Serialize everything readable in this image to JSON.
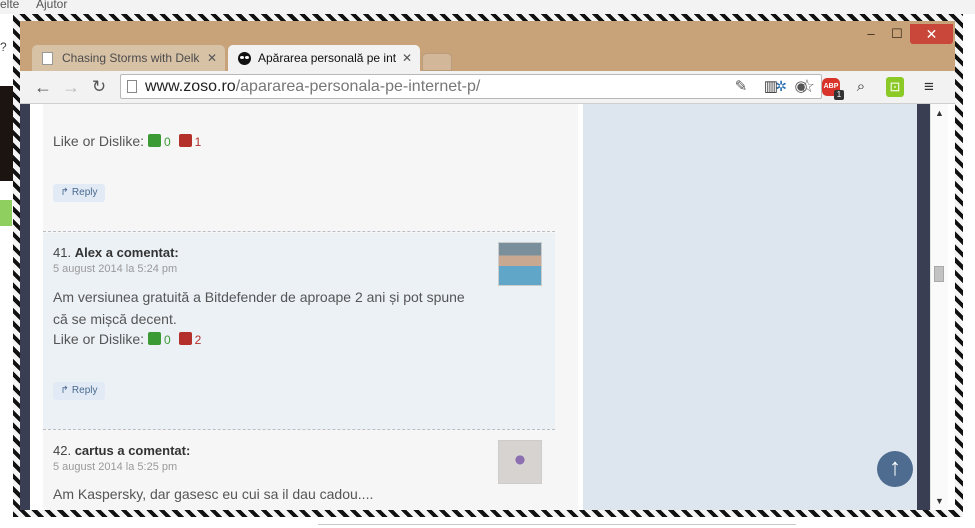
{
  "background": {
    "menu_left": "elte",
    "menu_right": "Ajutor",
    "q_mark": "?"
  },
  "window": {
    "min": "–",
    "max": "☐",
    "close": "✕"
  },
  "tabs": [
    {
      "label": "Chasing Storms with Delk",
      "close": "✕",
      "icon": "page-icon"
    },
    {
      "label": "Apărarea personală pe int",
      "close": "✕",
      "icon": "alien-icon"
    }
  ],
  "toolbar": {
    "url_domain": "www.zoso.ro",
    "url_path": "/apararea-personala-pe-internet-p/",
    "abp_label": "ABP",
    "abp_badge": "1"
  },
  "comments": [
    {
      "likes_label": "Like or Dislike:",
      "likes": "0",
      "dislikes": "1",
      "reply": "Reply"
    },
    {
      "number": "41.",
      "author": "Alex",
      "suffix": "a comentat:",
      "date": "5 august 2014 la 5:24 pm",
      "text": "Am versiunea gratuită a Bitdefender de aproape 2 ani și pot spune că se mișcă decent.",
      "likes_label": "Like or Dislike:",
      "likes": "0",
      "dislikes": "2",
      "reply": "Reply"
    },
    {
      "number": "42.",
      "author": "cartus",
      "suffix": "a comentat:",
      "date": "5 august 2014 la 5:25 pm",
      "text": "Am Kaspersky, dar gasesc eu cui sa il dau cadou...."
    }
  ],
  "colors": {
    "frame": "#c8a278",
    "sidebar": "#dde6ef",
    "like_green": "#3c9a35",
    "dislike_red": "#b3312a",
    "accent": "#4e6c8f"
  }
}
